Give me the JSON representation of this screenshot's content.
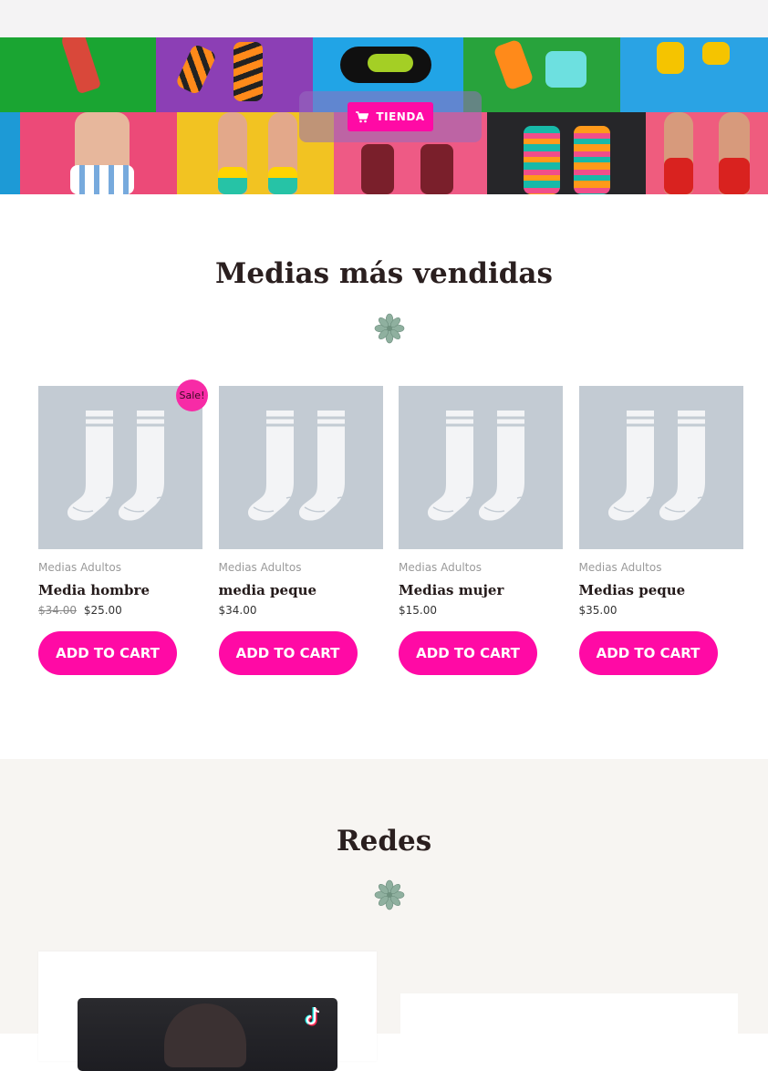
{
  "hero": {
    "cta_label": "TIENDA",
    "cta_icon": "cart-icon"
  },
  "bestsellers": {
    "title": "Medias más vendidas",
    "divider_icon": "flower-icon",
    "products": [
      {
        "category": "Medias Adultos",
        "name": "Media hombre",
        "old_price": "$34.00",
        "price": "$25.00",
        "badge": "Sale!",
        "button": "ADD TO CART"
      },
      {
        "category": "Medias Adultos",
        "name": "media peque",
        "old_price": "",
        "price": "$34.00",
        "badge": "",
        "button": "ADD TO CART"
      },
      {
        "category": "Medias Adultos",
        "name": "Medias mujer",
        "old_price": "",
        "price": "$15.00",
        "badge": "",
        "button": "ADD TO CART"
      },
      {
        "category": "Medias Adultos",
        "name": "Medias peque",
        "old_price": "",
        "price": "$35.00",
        "badge": "",
        "button": "ADD TO CART"
      }
    ]
  },
  "redes": {
    "title": "Redes",
    "divider_icon": "flower-icon",
    "video_icon": "tiktok-icon"
  },
  "colors": {
    "accent": "#ff0aa5",
    "placeholder_bg": "#c3cbd3",
    "section_bg": "#f7f5f2",
    "flower": "#8fb09f"
  }
}
